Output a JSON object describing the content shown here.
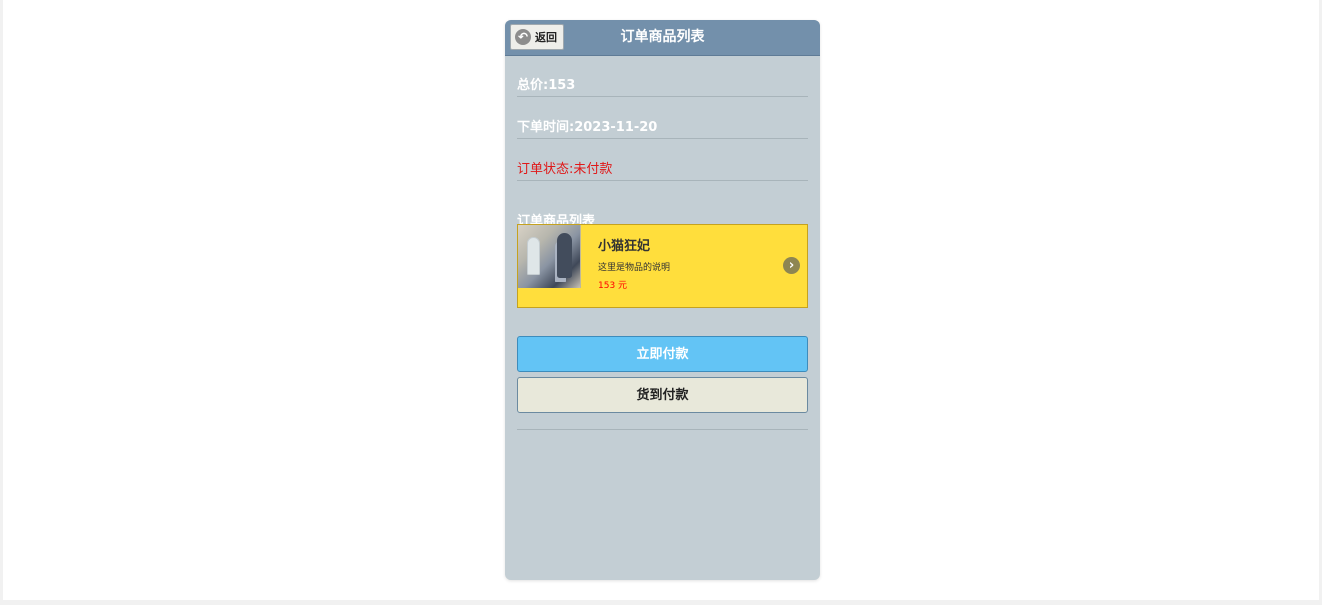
{
  "header": {
    "back_label": "返回",
    "title": "订单商品列表"
  },
  "order": {
    "total_label": "总价:153",
    "time_label": "下单时间:2023-11-20",
    "status_label": "订单状态:未付款",
    "section_title": "订单商品列表"
  },
  "product": {
    "name": "小猫狂妃",
    "description": "这里是物品的说明",
    "price": "153 元"
  },
  "actions": {
    "pay_now": "立即付款",
    "cash_on_delivery": "货到付款"
  },
  "icons": {
    "back": "back-icon",
    "chevron": "chevron-right-icon"
  },
  "colors": {
    "header": "#7390ab",
    "panel": "#c3ced4",
    "card": "#ffde3c",
    "primary": "#63c4f5",
    "secondary": "#e8e8da",
    "status": "#e01818",
    "price": "#ff0000"
  }
}
